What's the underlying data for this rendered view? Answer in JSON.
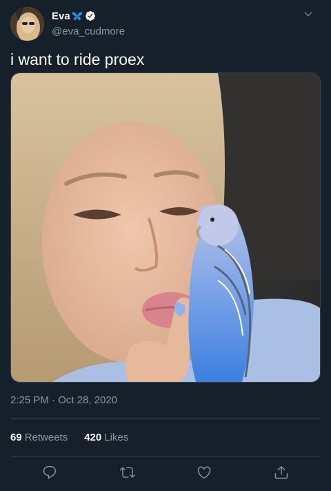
{
  "user": {
    "display_name": "Eva",
    "handle": "@eva_cudmore",
    "verified": true,
    "name_emoji": "butterfly-icon"
  },
  "tweet": {
    "text": "i want to ride proex",
    "timestamp": "2:25 PM · Oct 28, 2020"
  },
  "stats": {
    "retweets_count": "69",
    "retweets_label": "Retweets",
    "likes_count": "420",
    "likes_label": "Likes"
  },
  "actions": [
    "reply-icon",
    "retweet-icon",
    "like-icon",
    "share-icon"
  ],
  "colors": {
    "background": "#15202b",
    "primary_text": "#ffffff",
    "secondary_text": "#8899a6",
    "divider": "#38444d",
    "verified_blue": "#ffffff",
    "butterfly_blue": "#1d9bf0"
  }
}
